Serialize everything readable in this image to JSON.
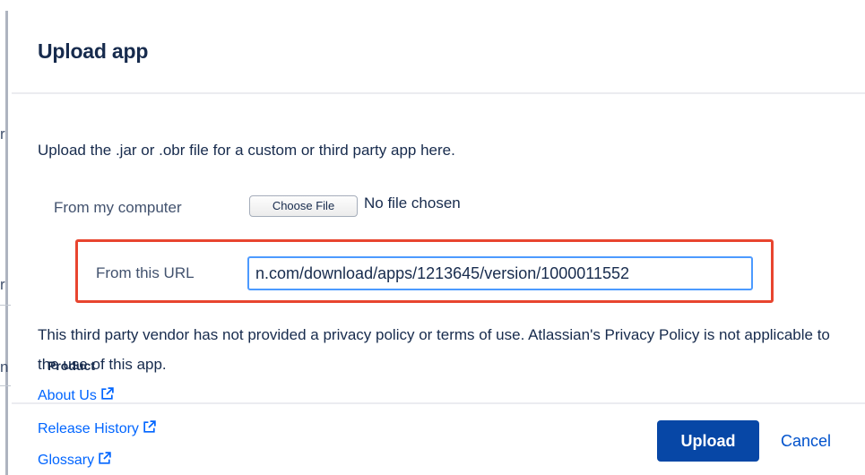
{
  "background_edge": {
    "chars": [
      "r",
      "r",
      "n"
    ]
  },
  "dialog": {
    "title": "Upload app",
    "intro": "Upload the .jar or .obr file for a custom or third party app here.",
    "from_computer_label": "From my computer",
    "choose_file_label": "Choose File",
    "file_status": "No file chosen",
    "from_url_label": "From this URL",
    "url_value": "n.com/download/apps/1213645/version/1000011552",
    "notice": "This third party vendor has not provided a privacy policy or terms of use. Atlassian's Privacy Policy is not applicable to the use of this app.",
    "upload_label": "Upload",
    "cancel_label": "Cancel"
  },
  "footer": {
    "heading": "Product",
    "links": [
      {
        "label": "About Us",
        "icon": "external-link-icon"
      },
      {
        "label": "Release History",
        "icon": "external-link-icon"
      },
      {
        "label": "Glossary",
        "icon": "external-link-icon"
      }
    ]
  },
  "colors": {
    "primary": "#0747a6",
    "link": "#0065ff",
    "highlight": "#e8452f",
    "focus": "#4c9aff"
  }
}
